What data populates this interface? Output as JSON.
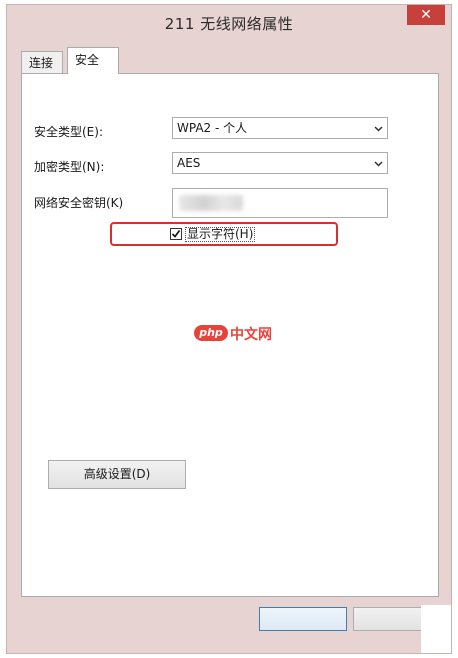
{
  "window": {
    "title": "211 无线网络属性",
    "close_glyph": "✕"
  },
  "tabs": [
    {
      "label": "连接",
      "active": false
    },
    {
      "label": "安全",
      "active": true
    }
  ],
  "security": {
    "type_label": "安全类型(E):",
    "type_value": "WPA2 - 个人",
    "encryption_label": "加密类型(N):",
    "encryption_value": "AES",
    "key_label": "网络安全密钥(K)",
    "show_chars_label": "显示字符(H)",
    "show_chars_checked": true
  },
  "advanced_button": "高级设置(D)",
  "watermark": {
    "badge": "php",
    "text": "中文网"
  },
  "colors": {
    "close": "#c7403b",
    "highlight": "#d8302f",
    "watermark": "#e8433b"
  }
}
